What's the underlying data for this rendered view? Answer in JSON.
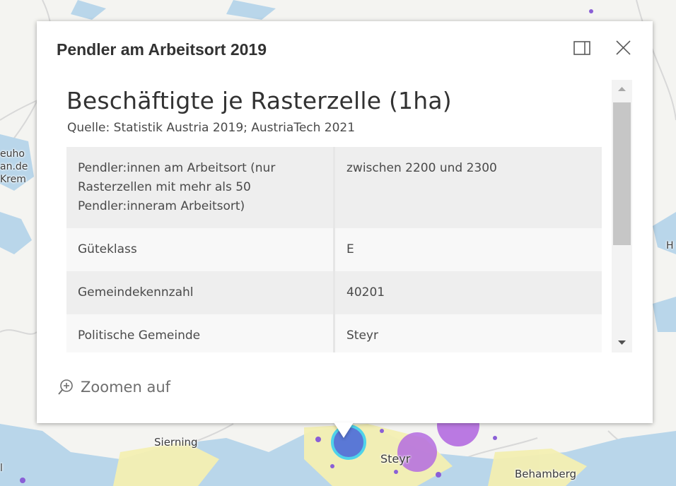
{
  "popup": {
    "title": "Pendler am Arbeitsort 2019",
    "dock_icon": "dock-panel-icon",
    "close_icon": "close-icon"
  },
  "content": {
    "heading": "Beschäftigte je Rasterzelle (1ha)",
    "source": "Quelle: Statistik Austria 2019; AustriaTech 2021",
    "attributes": [
      {
        "label": "Pendler:innen am Arbeitsort (nur Rasterzellen mit mehr als 50 Pendler:inneram Arbeitsort)",
        "value": "zwischen 2200 und 2300"
      },
      {
        "label": "Güteklass",
        "value": "E"
      },
      {
        "label": "Gemeindekennzahl",
        "value": "40201"
      },
      {
        "label": "Politische Gemeinde",
        "value": "Steyr"
      }
    ]
  },
  "actions": {
    "zoom_label": "Zoomen auf",
    "zoom_icon": "zoom-in-icon"
  },
  "map": {
    "labels": {
      "sierning": "Sierning",
      "steyr": "Steyr",
      "behamberg": "Behamberg",
      "neuho_fragment": "euho",
      "an_de_fragment": "an.de",
      "krem_fragment": "Krem",
      "h_fragment": "H",
      "l_fragment": "l"
    },
    "colors": {
      "water": "#b9d6ea",
      "urban": "#f3efb2",
      "cluster_blue": "#5a78d6",
      "cluster_purple": "#b46be0"
    }
  }
}
